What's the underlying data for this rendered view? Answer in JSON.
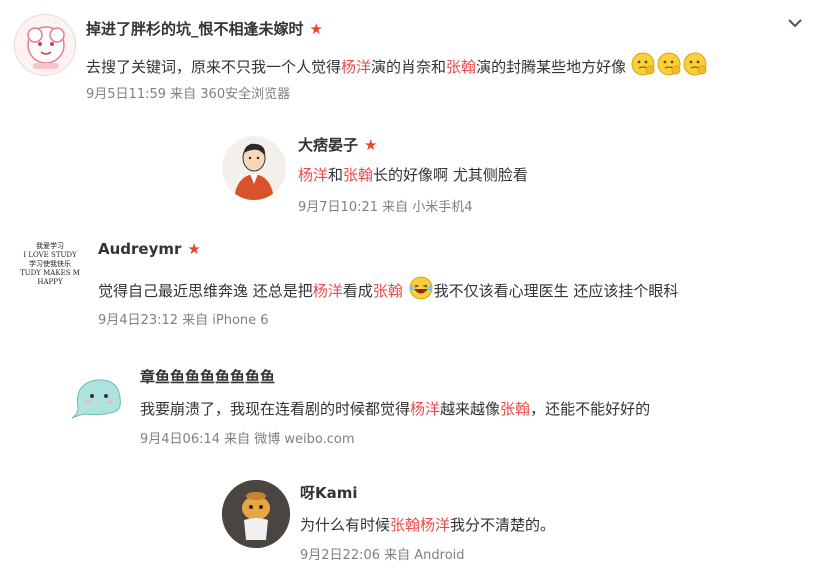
{
  "collapse_icon": "chevron-down-icon",
  "comments": [
    {
      "name": "掉进了胖杉的坑_恨不相逢未嫁时",
      "star": "★",
      "text_parts": [
        "去搜了关键词，原来不只我一个人觉得",
        "杨洋",
        "演的肖奈和",
        "张翰",
        "演的封腾某些地方好像"
      ],
      "meta": "9月5日11:59 来自 360安全浏览器"
    },
    {
      "name": "大痞晏子",
      "star": "★",
      "text_parts": [
        "杨洋",
        "和",
        "张翰",
        "长的好像啊 尤其侧脸看"
      ],
      "meta": "9月7日10:21 来自 小米手机4"
    },
    {
      "name": "Audreymr",
      "star": "★",
      "avatar_lines": [
        "我爱学习",
        "I LOVE STUDY",
        "学习使我快乐",
        "TUDY MAKES M",
        "HAPPY"
      ],
      "text_parts": [
        "觉得自己最近思维奔逸 还总是把",
        "杨洋",
        "看成",
        "张翰",
        "我不仅该看心理医生 还应该挂个眼科"
      ],
      "meta": "9月4日23:12 来自 iPhone 6"
    },
    {
      "name": "章鱼鱼鱼鱼鱼鱼鱼鱼",
      "text_parts": [
        "我要崩溃了，我现在连看剧的时候都觉得",
        "杨洋",
        "越来越像",
        "张翰",
        "，还能不能好好的"
      ],
      "meta": "9月4日06:14 来自 微博 weibo.com"
    },
    {
      "name": "呀Kami",
      "text_parts": [
        "为什么有时候",
        "张翰",
        "杨洋",
        "我分不清楚的。"
      ],
      "meta": "9月2日22:06 来自 Android"
    }
  ]
}
